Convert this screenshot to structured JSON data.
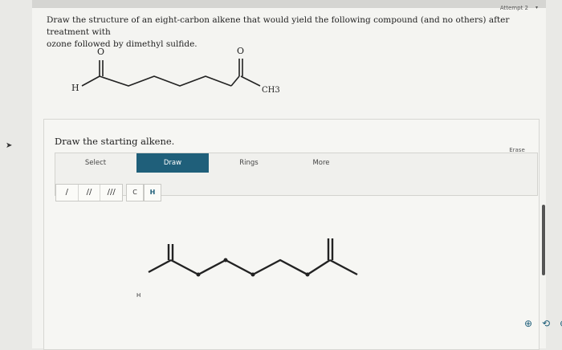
{
  "header": {
    "attempt_label": "Attempt 2",
    "caret": "▾"
  },
  "question": {
    "line1": "Draw the structure of an eight-carbon alkene that would yield the following compound (and no others) after treatment with",
    "line2": "ozone followed by dimethyl sulfide."
  },
  "product_molecule": {
    "left_h": "H",
    "oxygen_left": "O",
    "oxygen_right": "O",
    "methyl": "CH3"
  },
  "editor": {
    "title": "Draw the starting alkene.",
    "toolbar": {
      "select": "Select",
      "draw": "Draw",
      "rings": "Rings",
      "more": "More",
      "erase": "Erase"
    },
    "bond_buttons": [
      "/",
      "//",
      "///"
    ],
    "atom_buttons": [
      "C",
      "H"
    ],
    "canvas_h_label": "H",
    "zoom": {
      "zoom_in": "⊕",
      "reset": "⟲",
      "zoom_out": "⊖"
    }
  },
  "colors": {
    "accent": "#1f5f7a",
    "page_bg": "#f4f4f1"
  },
  "icons": [
    "zoom-in-icon",
    "reset-icon",
    "zoom-out-icon",
    "cursor-arrow-icon"
  ]
}
